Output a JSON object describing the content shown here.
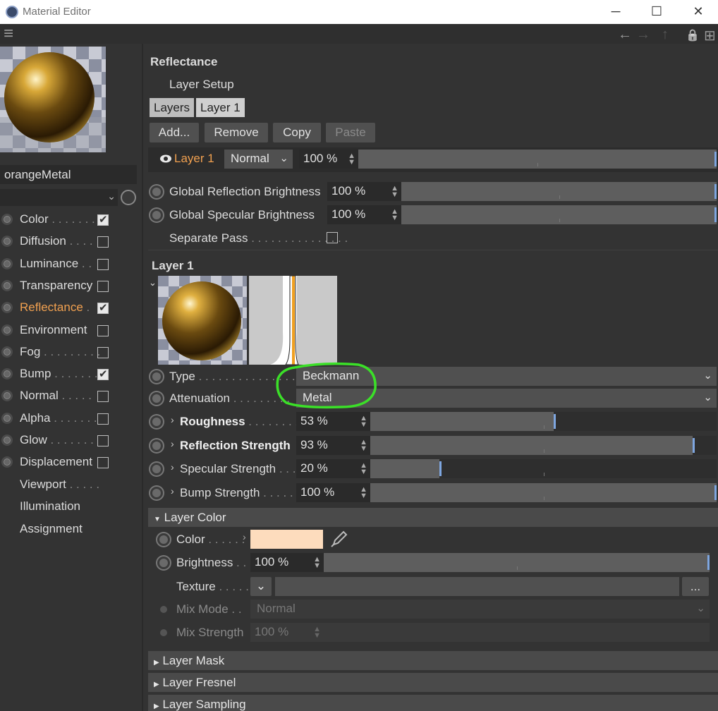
{
  "window": {
    "title": "Material Editor",
    "minimize": "─",
    "maximize": "☐",
    "close": "✕"
  },
  "toolbar": {
    "menu_icon": "≡",
    "back_icon": "←",
    "forward_icon": "→",
    "up_icon": "↑",
    "lock_icon": "🔒",
    "new_icon": "⊞"
  },
  "material": {
    "name": "orangeMetal"
  },
  "channels": [
    {
      "label": "Color",
      "dots": " . . . . . . .",
      "checked": true,
      "active": false
    },
    {
      "label": "Diffusion",
      "dots": " . . . .",
      "checked": false,
      "active": false
    },
    {
      "label": "Luminance",
      "dots": " . .",
      "checked": false,
      "active": false
    },
    {
      "label": "Transparency",
      "dots": "",
      "checked": false,
      "active": false
    },
    {
      "label": "Reflectance",
      "dots": " .",
      "checked": true,
      "active": true
    },
    {
      "label": "Environment",
      "dots": "",
      "checked": false,
      "active": false
    },
    {
      "label": "Fog",
      "dots": " . . . . . . . . .",
      "checked": false,
      "active": false
    },
    {
      "label": "Bump",
      "dots": " . . . . . . .",
      "checked": true,
      "active": false
    },
    {
      "label": "Normal",
      "dots": " . . . . .",
      "checked": false,
      "active": false
    },
    {
      "label": "Alpha",
      "dots": " . . . . . . .",
      "checked": false,
      "active": false
    },
    {
      "label": "Glow",
      "dots": " . . . . . . .",
      "checked": false,
      "active": false
    },
    {
      "label": "Displacement",
      "dots": "",
      "checked": false,
      "active": false
    }
  ],
  "extras": [
    {
      "label": "Viewport",
      "dots": " . . . . ."
    },
    {
      "label": "Illumination",
      "dots": ""
    },
    {
      "label": "Assignment",
      "dots": ""
    }
  ],
  "reflectance": {
    "title": "Reflectance",
    "layer_setup": "Layer Setup",
    "tabs": [
      "Layers",
      "Layer 1"
    ],
    "buttons": {
      "add": "Add...",
      "remove": "Remove",
      "copy": "Copy",
      "paste": "Paste"
    },
    "layer_row": {
      "name": "Layer 1",
      "mode": "Normal",
      "opacity": "100 %",
      "opacity_fraction": 1.0
    },
    "global_reflection": {
      "label": "Global Reflection Brightness",
      "value": "100 %",
      "fraction": 1.0
    },
    "global_specular": {
      "label": "Global Specular Brightness",
      "value": "100 %",
      "fraction": 1.0
    },
    "separate_pass": {
      "label": "Separate Pass",
      "dots": " . . . . . . . . . . . . . . ."
    }
  },
  "layer1": {
    "title": "Layer 1",
    "type": {
      "label": "Type",
      "dots": " . . . . . . . . . . . . . . .",
      "value": "Beckmann"
    },
    "attenuation": {
      "label": "Attenuation",
      "dots": " . . . . . . . . .",
      "value": "Metal"
    },
    "roughness": {
      "label": "Roughness",
      "dots": " . . . . . . . . .",
      "value": "53 %",
      "fraction": 0.53
    },
    "reflection_strength": {
      "label": "Reflection Strength",
      "value": "93 %",
      "fraction": 0.93
    },
    "specular_strength": {
      "label": "Specular Strength",
      "dots": " . . .",
      "value": "20 %",
      "fraction": 0.2
    },
    "bump_strength": {
      "label": "Bump Strength",
      "dots": " . . . . . .",
      "value": "100 %",
      "fraction": 1.0
    }
  },
  "layer_color": {
    "title": "Layer Color",
    "color": {
      "label": "Color",
      "dots": " . . . . . .",
      "swatch": "#fddcbd"
    },
    "brightness": {
      "label": "Brightness",
      "dots": " . .",
      "value": "100 %",
      "fraction": 1.0
    },
    "texture": {
      "label": "Texture",
      "dots": " . . . . . .",
      "more": "..."
    },
    "mix_mode": {
      "label": "Mix Mode",
      "dots": " . .",
      "value": "Normal"
    },
    "mix_strength": {
      "label": "Mix Strength",
      "value": "100 %"
    }
  },
  "sections": [
    "Layer Mask",
    "Layer Fresnel",
    "Layer Sampling"
  ],
  "colors": {
    "accent": "#f0a050",
    "annotation": "#3be028",
    "slider_knob": "#7ea6e0"
  }
}
